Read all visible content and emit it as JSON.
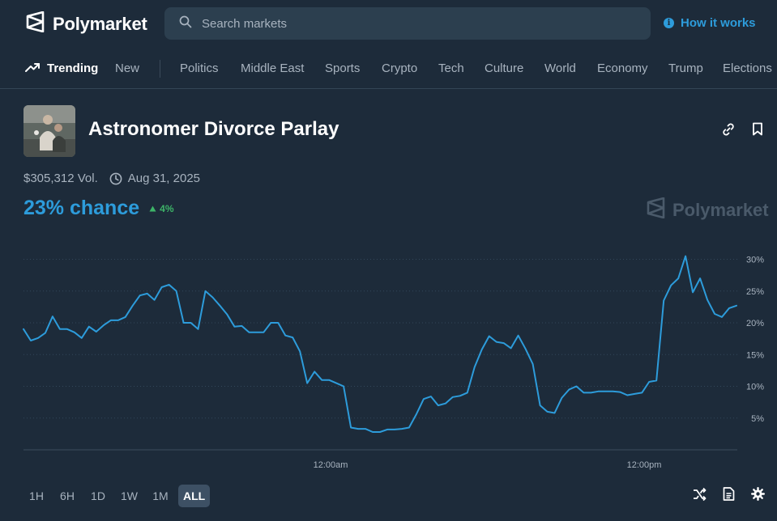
{
  "header": {
    "brand": "Polymarket",
    "search_placeholder": "Search markets",
    "how_it_works": "How it works"
  },
  "nav": {
    "trending": "Trending",
    "items": [
      "New",
      "Politics",
      "Middle East",
      "Sports",
      "Crypto",
      "Tech",
      "Culture",
      "World",
      "Economy",
      "Trump",
      "Elections"
    ]
  },
  "market": {
    "title": "Astronomer Divorce Parlay",
    "volume": "$305,312 Vol.",
    "end_date": "Aug 31, 2025",
    "chance": "23% chance",
    "change": "4%",
    "watermark": "Polymarket"
  },
  "chart_data": {
    "type": "line",
    "title": "",
    "xlabel": "",
    "ylabel": "",
    "x_tick_labels": [
      "12:00am",
      "12:00pm"
    ],
    "y_tick_labels": [
      "30%",
      "25%",
      "20%",
      "15%",
      "10%",
      "5%"
    ],
    "ylim": [
      0,
      30
    ],
    "series": [
      {
        "color": "#2d9cdb",
        "values": [
          19,
          17.2,
          17.6,
          18.4,
          21,
          19,
          19,
          18.5,
          17.6,
          19.4,
          18.6,
          19.6,
          20.4,
          20.4,
          20.9,
          22.7,
          24.3,
          24.6,
          23.6,
          25.6,
          26,
          25,
          20,
          20,
          19,
          25,
          24,
          22.7,
          21.3,
          19.4,
          19.5,
          18.5,
          18.5,
          18.5,
          20,
          20,
          18,
          17.7,
          15.5,
          10.5,
          12.3,
          11,
          11,
          10.5,
          10,
          3.5,
          3.3,
          3.3,
          2.8,
          2.8,
          3.2,
          3.2,
          3.3,
          3.5,
          5.6,
          8,
          8.4,
          7,
          7.3,
          8.3,
          8.5,
          9,
          13,
          15.8,
          17.9,
          17,
          16.8,
          16,
          18,
          15.9,
          13.5,
          7,
          6,
          5.8,
          8.2,
          9.5,
          10,
          9,
          9,
          9.2,
          9.2,
          9.2,
          9.1,
          8.6,
          8.8,
          9,
          10.7,
          10.9,
          23.5,
          25.9,
          27,
          30.5,
          24.8,
          27,
          23.6,
          21.4,
          20.9,
          22.3,
          22.7
        ]
      }
    ]
  },
  "timeranges": [
    "1H",
    "6H",
    "1D",
    "1W",
    "1M",
    "ALL"
  ],
  "active_timerange": "ALL",
  "colors": {
    "background": "#1d2b3a",
    "accent": "#2d9cdb",
    "positive": "#3db468",
    "muted_text": "#a8b3bf"
  }
}
